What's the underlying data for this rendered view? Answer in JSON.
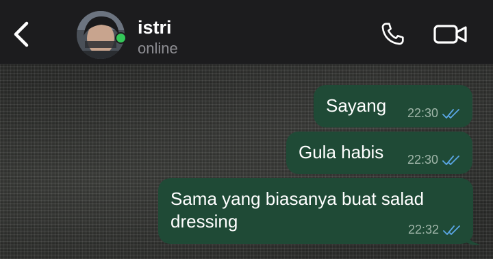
{
  "header": {
    "contact_name": "istri",
    "contact_status": "online",
    "icons": {
      "back": "chevron-left-icon",
      "call": "phone-icon",
      "video": "video-camera-icon"
    }
  },
  "messages": [
    {
      "text": "Sayang",
      "time": "22:30",
      "status": "read",
      "direction": "outgoing"
    },
    {
      "text": "Gula habis",
      "time": "22:30",
      "status": "read",
      "direction": "outgoing"
    },
    {
      "text": "Sama yang biasanya buat salad dressing",
      "time": "22:32",
      "status": "read",
      "direction": "outgoing"
    }
  ],
  "colors": {
    "header_bg": "#1c1c1e",
    "bubble_bg": "#1f4a36",
    "read_tick": "#5aa7e6",
    "online_dot": "#34c759"
  }
}
